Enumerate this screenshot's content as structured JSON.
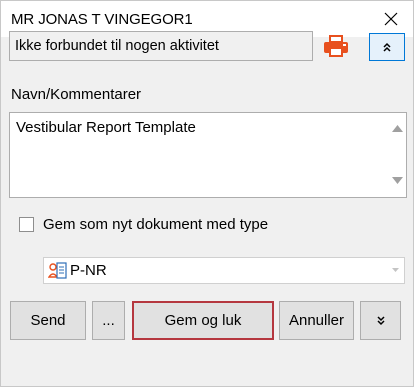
{
  "window": {
    "title": "MR JONAS T VINGEGOR1",
    "close_icon": "close-icon"
  },
  "activity": {
    "text": "Ikke forbundet til nogen aktivitet",
    "print_icon": "printer-icon",
    "collapse_icon": "chevron-double-up-icon"
  },
  "comments": {
    "label": "Navn/Kommentarer",
    "value": "Vestibular Report Template"
  },
  "save_new": {
    "label": "Gem som nyt dokument med type",
    "checked": false
  },
  "doc_type": {
    "selected": "P-NR",
    "icon": "patient-document-icon"
  },
  "buttons": {
    "send": "Send",
    "more": "...",
    "save_close": "Gem og luk",
    "cancel": "Annuller",
    "expand_icon": "chevron-double-down-icon"
  },
  "colors": {
    "accent_border": "#b5373f",
    "print_orange": "#e8501e",
    "focus_blue": "#0078d7",
    "panel_bg": "#f0f0f0"
  }
}
